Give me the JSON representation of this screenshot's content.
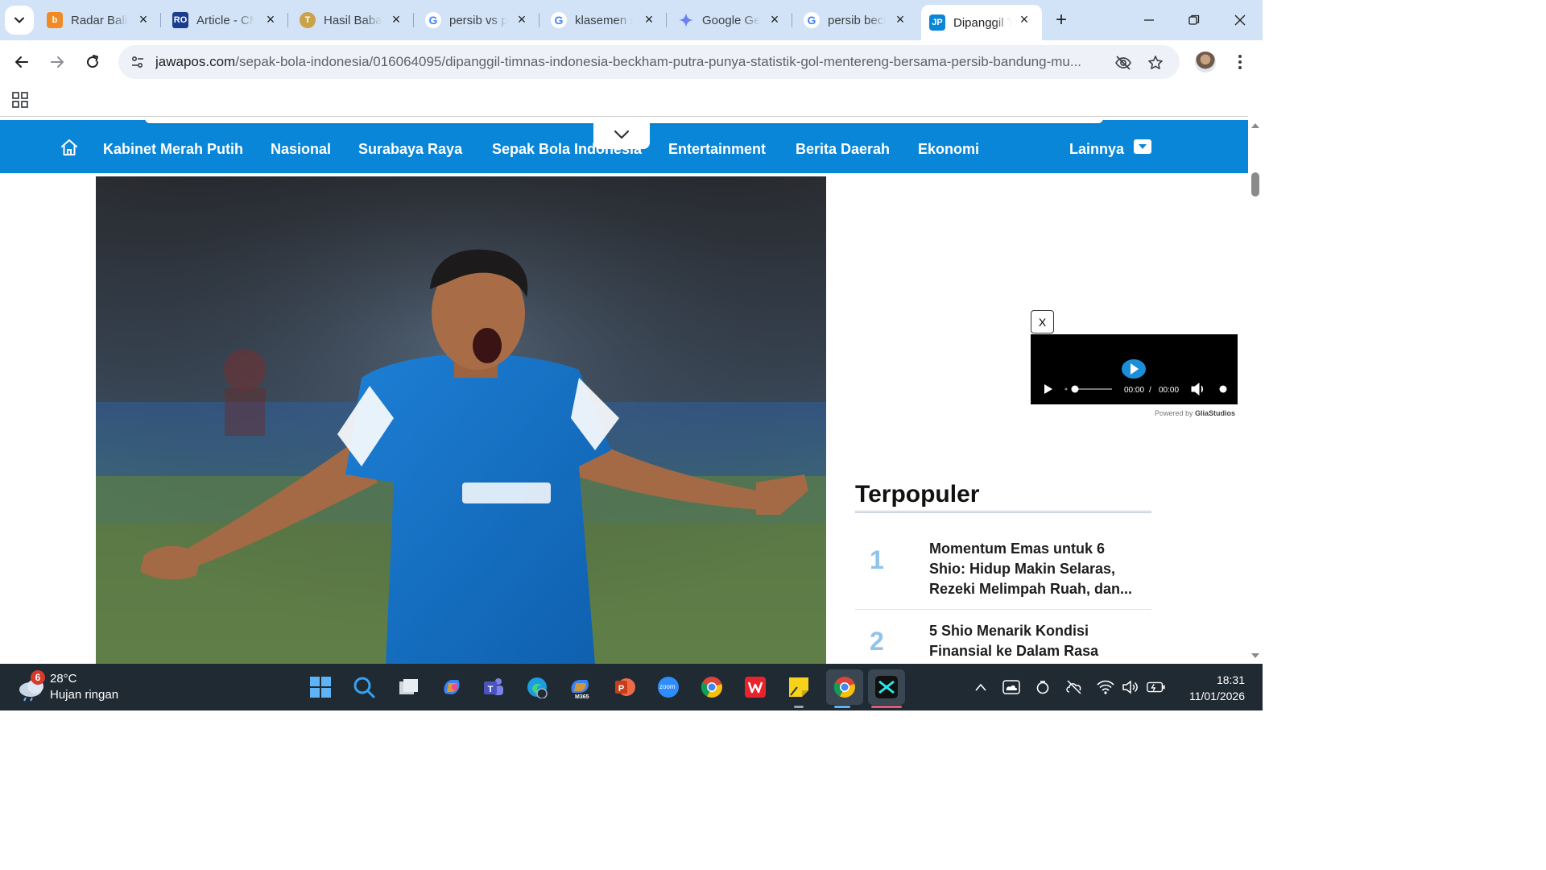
{
  "browser": {
    "tabs": [
      {
        "title": "Radar Bali",
        "favicon": "radar-bali-icon",
        "color": "#f08a24"
      },
      {
        "title": "Article - CM",
        "favicon": "ro-icon",
        "color": "#1a3d8f"
      },
      {
        "title": "Hasil Babak",
        "favicon": "t-icon",
        "color": "#c9a24a"
      },
      {
        "title": "persib vs pe",
        "favicon": "google-icon",
        "color": "#4285f4"
      },
      {
        "title": "klasemen su",
        "favicon": "google-icon",
        "color": "#4285f4"
      },
      {
        "title": "Google Gem",
        "favicon": "gemini-icon",
        "color": "#6c7ff2"
      },
      {
        "title": "persib beck",
        "favicon": "google-icon",
        "color": "#4285f4"
      },
      {
        "title": "Dipanggil Ti",
        "favicon": "jp-icon",
        "color": "#0a86d8",
        "active": true
      }
    ],
    "url_host": "jawapos.com",
    "url_path": "/sepak-bola-indonesia/016064095/dipanggil-timnas-indonesia-beckham-putra-punya-statistik-gol-mentereng-bersama-persib-bandung-mu..."
  },
  "site": {
    "nav": [
      "Kabinet Merah Putih",
      "Nasional",
      "Surabaya Raya",
      "Sepak Bola Indonesia",
      "Entertainment",
      "Berita Daerah",
      "Ekonomi"
    ],
    "more_label": "Lainnya",
    "accent": "#0a86d8"
  },
  "video": {
    "close_label": "X",
    "time_current": "00:00",
    "time_sep": "/",
    "time_total": "00:00",
    "powered_prefix": "Powered by ",
    "powered_brand": "GliaStudios"
  },
  "popular": {
    "heading": "Terpopuler",
    "items": [
      {
        "rank": "1",
        "title": "Momentum Emas untuk 6 Shio: Hidup Makin Selaras, Rezeki Melimpah Ruah, dan..."
      },
      {
        "rank": "2",
        "title": "5 Shio Menarik Kondisi Finansial ke Dalam Rasa"
      }
    ]
  },
  "taskbar": {
    "weather_badge": "6",
    "temperature": "28°C",
    "weather_desc": "Hujan ringan",
    "time": "18:31",
    "date": "11/01/2026",
    "m365_label": "M365",
    "zoom_label": "zoom"
  }
}
